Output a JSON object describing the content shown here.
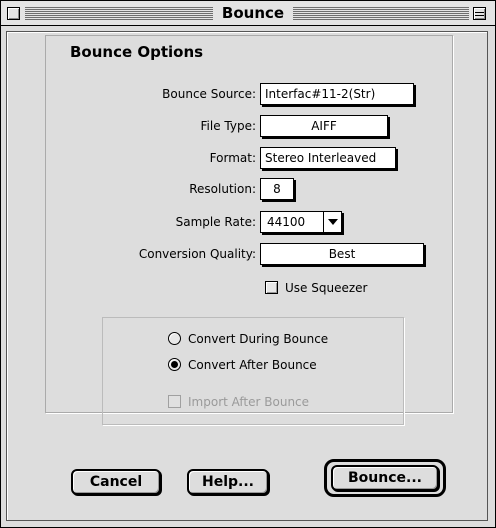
{
  "window": {
    "title": "Bounce"
  },
  "group": {
    "title": "Bounce Options"
  },
  "fields": {
    "bounce_source": {
      "label": "Bounce Source:",
      "value": "Interfac#11-2(Str)"
    },
    "file_type": {
      "label": "File Type:",
      "value": "AIFF"
    },
    "format": {
      "label": "Format:",
      "value": "Stereo Interleaved"
    },
    "resolution": {
      "label": "Resolution:",
      "value": "8"
    },
    "sample_rate": {
      "label": "Sample Rate:",
      "value": "44100"
    },
    "conversion_quality": {
      "label": "Conversion Quality:",
      "value": "Best"
    }
  },
  "use_squeezer": {
    "label": "Use Squeezer",
    "checked": false
  },
  "convert": {
    "options": [
      {
        "label": "Convert During Bounce",
        "selected": false
      },
      {
        "label": "Convert After Bounce",
        "selected": true
      }
    ],
    "import_after": {
      "label": "Import After Bounce",
      "checked": false,
      "enabled": false
    }
  },
  "buttons": {
    "cancel": "Cancel",
    "help": "Help...",
    "bounce": "Bounce..."
  },
  "icons": {
    "close": "close-box-icon",
    "collapse": "collapse-box-icon",
    "dropdown": "chevron-down-icon"
  }
}
